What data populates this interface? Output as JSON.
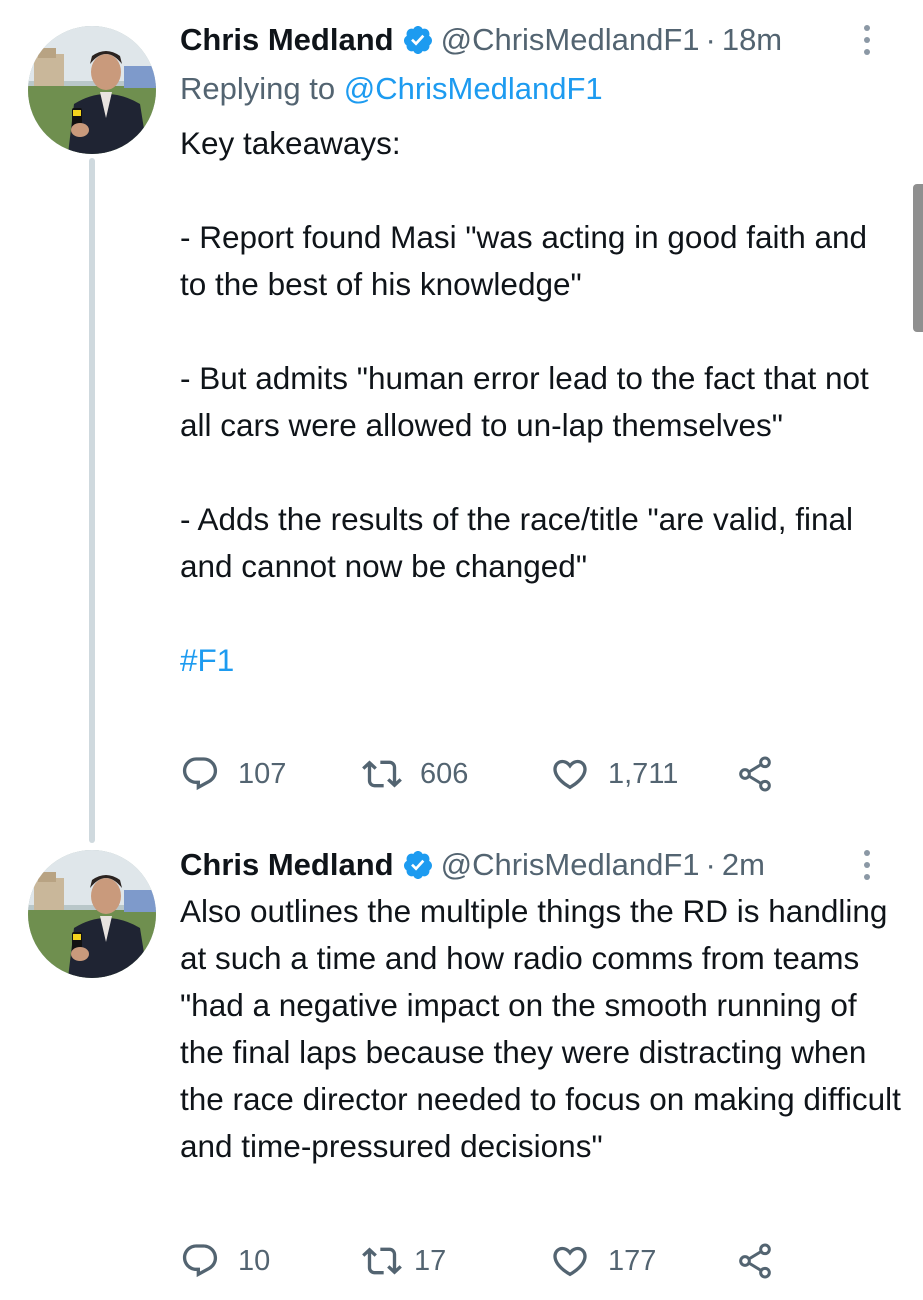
{
  "tweets": [
    {
      "author": "Chris Medland",
      "handle": "@ChrisMedlandF1",
      "separator": "·",
      "time": "18m",
      "replying_prefix": "Replying to",
      "replying_handle": "@ChrisMedlandF1",
      "paragraphs": [
        "Key takeaways:",
        "- Report found Masi \"was acting in good faith and to the best of his knowledge\"",
        "- But admits \"human error lead to the fact that not all cars were allowed to un-lap themselves\"",
        "- Adds the results of the race/title \"are valid, final and cannot now be changed\"",
        "#F1"
      ],
      "counts": {
        "replies": "107",
        "retweets": "606",
        "likes": "1,711"
      }
    },
    {
      "author": "Chris Medland",
      "handle": "@ChrisMedlandF1",
      "separator": "·",
      "time": "2m",
      "paragraphs": [
        "Also outlines the multiple things the RD is handling at such a time and how radio comms from teams \"had a negative impact on the smooth running of the final laps because they were distracting when the race director needed to focus on making difficult and time-pressured decisions\""
      ],
      "counts": {
        "replies": "10",
        "retweets": "17",
        "likes": "177"
      }
    }
  ],
  "icons": {
    "verified": "verified-badge-icon",
    "reply": "reply-icon",
    "retweet": "retweet-icon",
    "like": "heart-icon",
    "share": "share-icon",
    "more": "more-options-icon"
  },
  "colors": {
    "link": "#1d9bf0",
    "secondary_text": "#536471",
    "primary_text": "#0f1419",
    "thread_line": "#cfd9de",
    "verified": "#1d9bf0"
  }
}
